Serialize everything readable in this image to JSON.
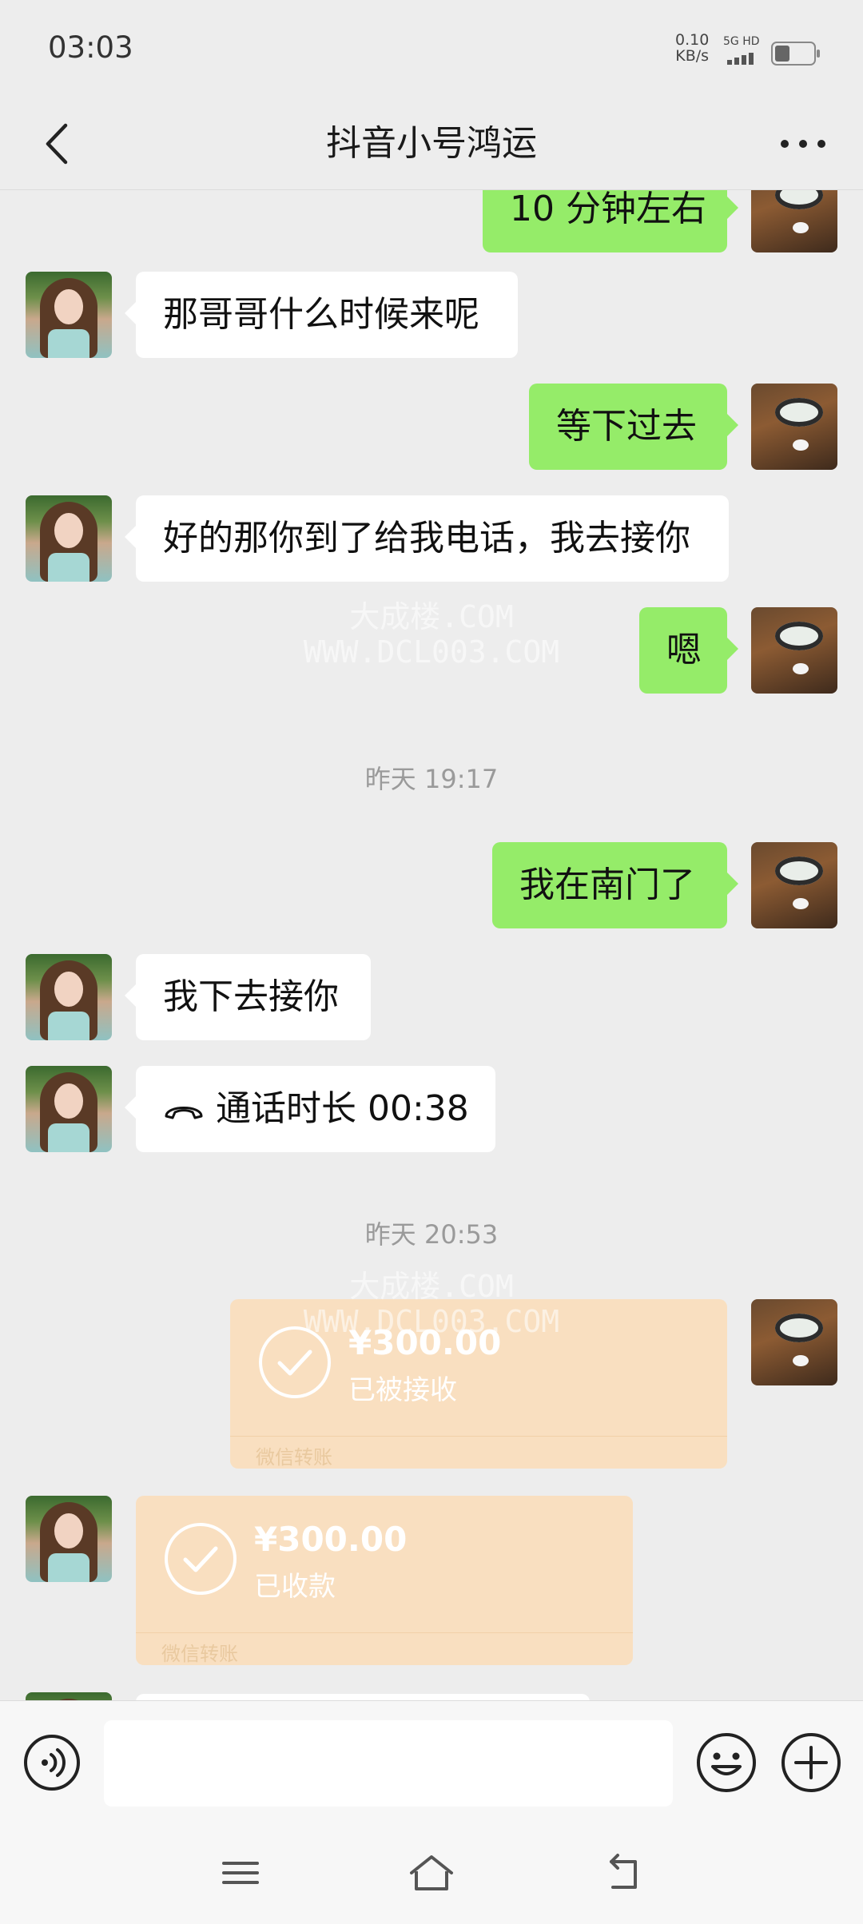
{
  "status_bar": {
    "time": "03:03",
    "net_speed": "0.10",
    "net_unit": "KB/s",
    "signal_label": "5G HD"
  },
  "header": {
    "title": "抖音小号鸿运"
  },
  "messages": {
    "m0": "10 分钟左右",
    "m1": "那哥哥什么时候来呢",
    "m2": "等下过去",
    "m3": "好的那你到了给我电话，我去接你",
    "m4": "嗯",
    "ts1": "昨天 19:17",
    "m5": "我在南门了",
    "m6": "我下去接你",
    "m7": "通话时长 00:38",
    "ts2": "昨天 20:53"
  },
  "transfers": {
    "sent": {
      "amount": "¥300.00",
      "status": "已被接收",
      "label": "微信转账"
    },
    "received": {
      "amount": "¥300.00",
      "status": "已收款",
      "label": "微信转账"
    }
  },
  "watermark": {
    "line1": "大成楼.COM",
    "line2": "WWW.DCL003.COM"
  },
  "input": {
    "placeholder": ""
  },
  "colors": {
    "sent_bubble": "#95ec69",
    "received_bubble": "#ffffff",
    "transfer": "#f9dfc0",
    "background": "#ededed"
  }
}
